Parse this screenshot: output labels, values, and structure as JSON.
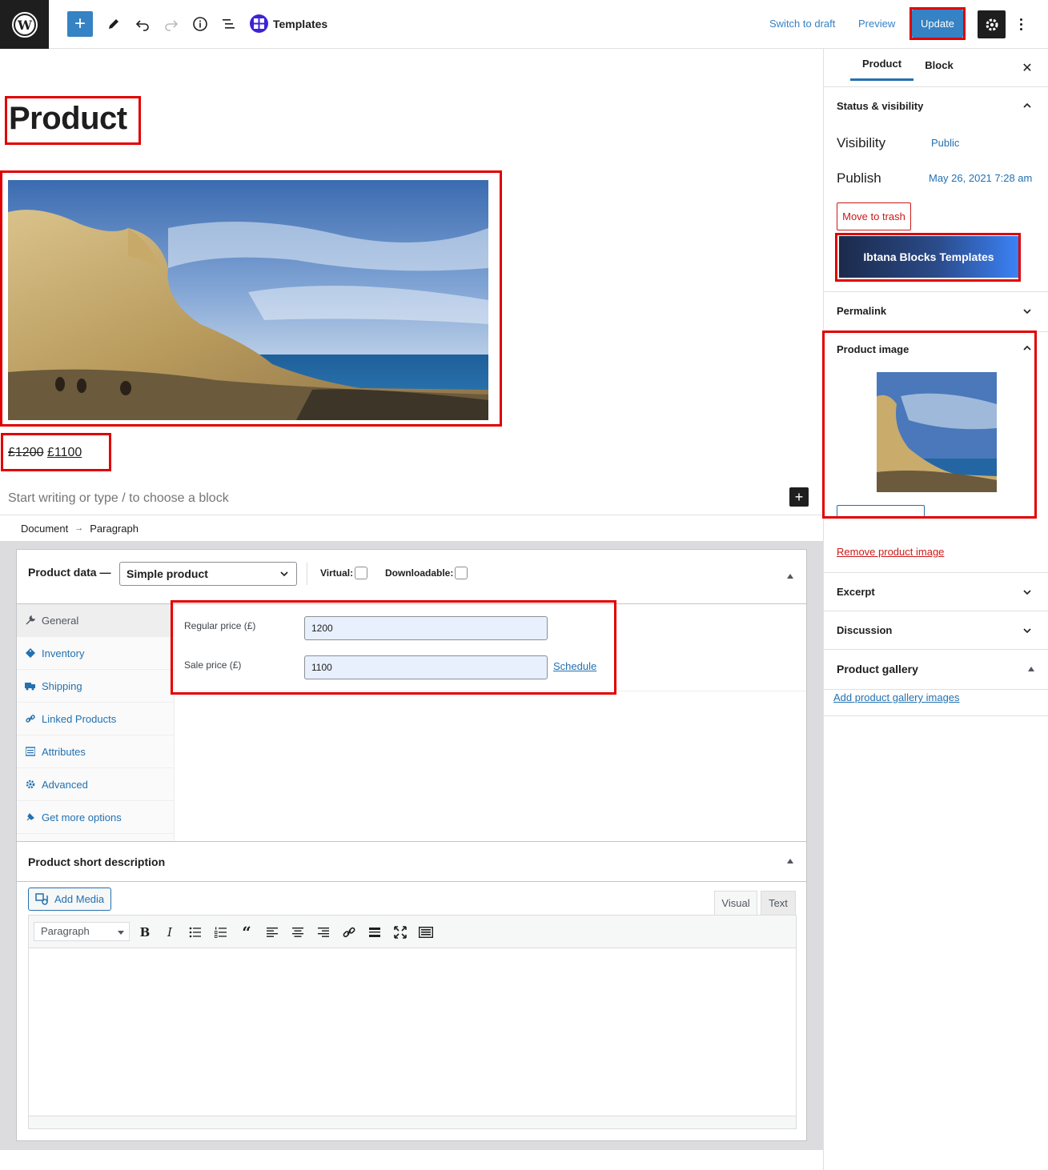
{
  "toolbar": {
    "templates_label": "Templates",
    "switch_to_draft": "Switch to draft",
    "preview": "Preview",
    "update": "Update"
  },
  "editor": {
    "post_title": "Product",
    "price_regular": "£1200",
    "price_sale": "£1100",
    "placeholder": "Start writing or type / to choose a block",
    "breadcrumb": [
      "Document",
      "Paragraph"
    ]
  },
  "product_data": {
    "title": "Product data —",
    "product_type": "Simple product",
    "virtual_label": "Virtual:",
    "downloadable_label": "Downloadable:",
    "tabs": [
      {
        "label": "General",
        "icon": "wrench-icon"
      },
      {
        "label": "Inventory",
        "icon": "tag-icon"
      },
      {
        "label": "Shipping",
        "icon": "truck-icon"
      },
      {
        "label": "Linked Products",
        "icon": "link-icon"
      },
      {
        "label": "Attributes",
        "icon": "list-icon"
      },
      {
        "label": "Advanced",
        "icon": "gear-icon"
      },
      {
        "label": "Get more options",
        "icon": "plugin-icon"
      }
    ],
    "regular_price_label": "Regular price (£)",
    "regular_price_value": "1200",
    "sale_price_label": "Sale price (£)",
    "sale_price_value": "1100",
    "schedule_link": "Schedule"
  },
  "short_description": {
    "title": "Product short description",
    "add_media": "Add Media",
    "tab_visual": "Visual",
    "tab_text": "Text",
    "format_select": "Paragraph"
  },
  "sidebar": {
    "tab_product": "Product",
    "tab_block": "Block",
    "status_title": "Status & visibility",
    "visibility_label": "Visibility",
    "visibility_value": "Public",
    "publish_label": "Publish",
    "publish_value": "May 26, 2021 7:28 am",
    "move_to_trash": "Move to trash",
    "ibtana_button": "Ibtana Blocks Templates",
    "permalink_title": "Permalink",
    "product_image_title": "Product image",
    "remove_product_image": "Remove product image",
    "excerpt_title": "Excerpt",
    "discussion_title": "Discussion",
    "gallery_title": "Product gallery",
    "add_gallery_images": "Add product gallery images"
  },
  "colors": {
    "accent": "#3582c4",
    "highlight": "#e00000",
    "dark": "#1e1e1e"
  }
}
